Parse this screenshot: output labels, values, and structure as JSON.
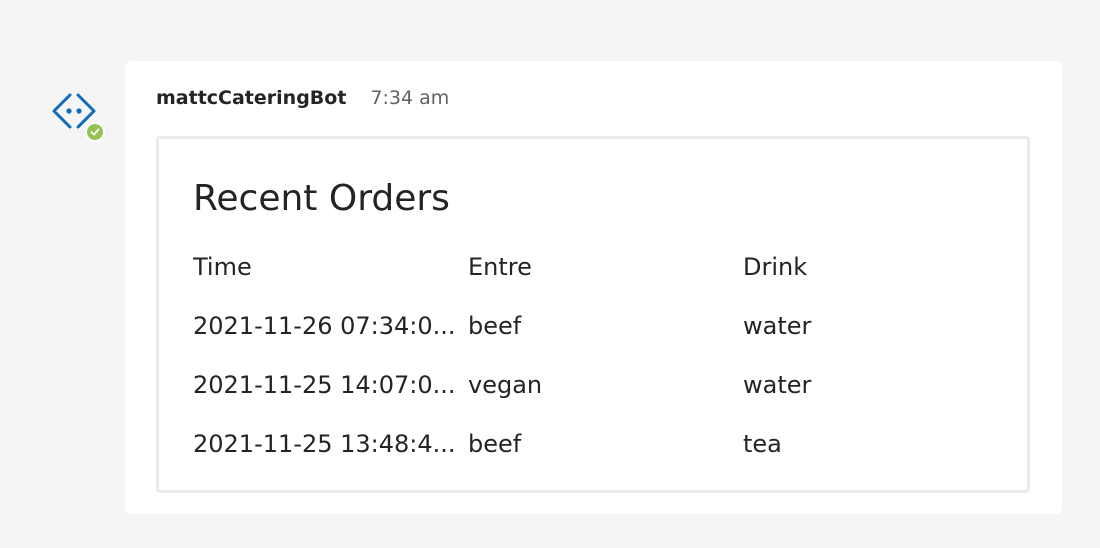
{
  "bot": {
    "avatar_icon": "bot-code-icon",
    "status_icon": "checkmark-icon",
    "status_color": "#92c353",
    "accent_color": "#0f6cbd"
  },
  "message": {
    "sender": "mattcCateringBot",
    "timestamp": "7:34 am"
  },
  "card": {
    "title": "Recent Orders",
    "columns": [
      "Time",
      "Entre",
      "Drink"
    ],
    "rows": [
      [
        "2021-11-26 07:34:0...",
        "beef",
        "water"
      ],
      [
        "2021-11-25 14:07:0...",
        "vegan",
        "water"
      ],
      [
        "2021-11-25 13:48:4...",
        "beef",
        "tea"
      ]
    ]
  }
}
